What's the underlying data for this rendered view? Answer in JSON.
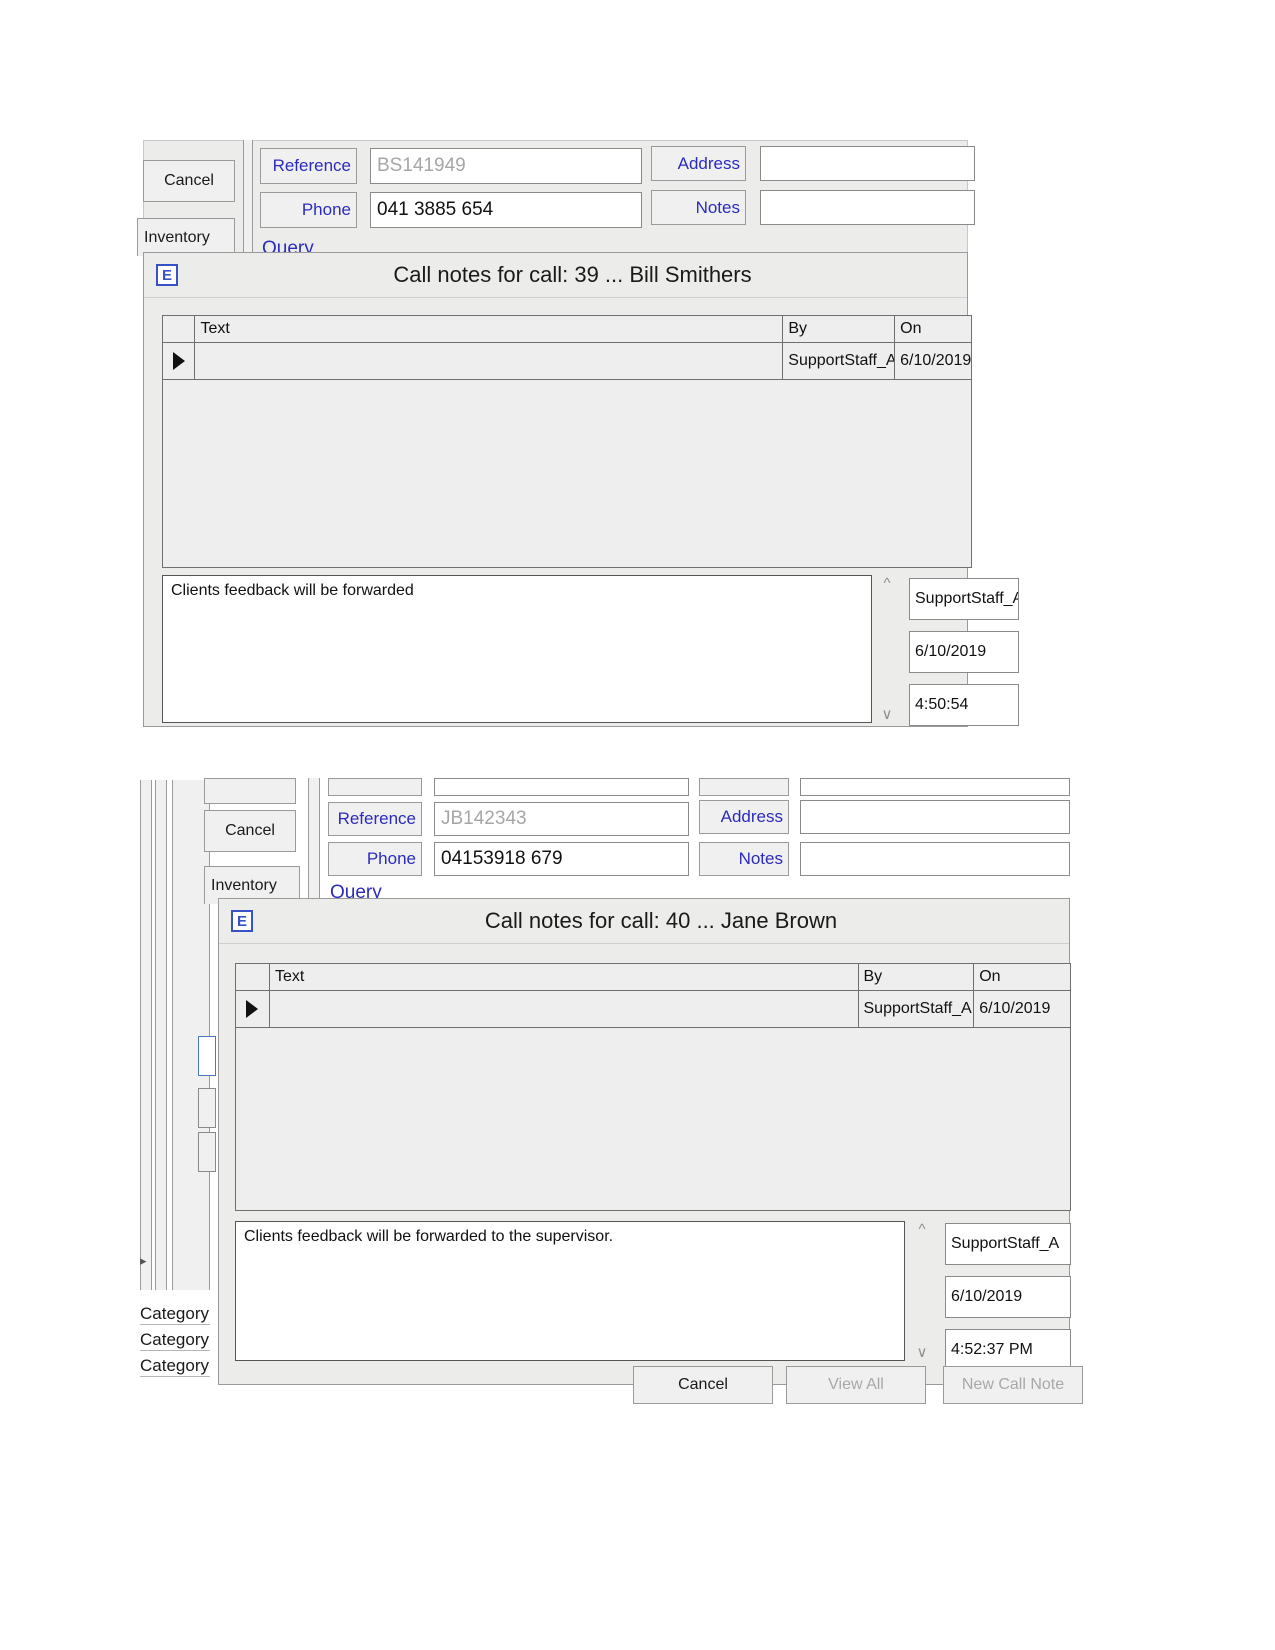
{
  "app": {
    "icon": "e-icon",
    "window_bg": "#ececeb"
  },
  "screen1": {
    "form": {
      "cancel_button": "Cancel",
      "inventory_tab": "Inventory",
      "query_label": "Query",
      "reference_label": "Reference",
      "reference_value": "BS141949",
      "phone_label": "Phone",
      "phone_value": "041 3885 654",
      "address_label": "Address",
      "address_value": "",
      "notes_label": "Notes",
      "notes_value": ""
    },
    "dialog": {
      "title": "Call notes for call:  39 ... Bill Smithers",
      "columns": [
        "Text",
        "By",
        "On"
      ],
      "rows": [
        {
          "selected": true,
          "text": "",
          "by": "SupportStaff_A",
          "on": "6/10/2019"
        }
      ],
      "note_text": "Clients feedback will be forwarded",
      "meta_by": "SupportStaff_A",
      "meta_date": "6/10/2019",
      "meta_time": "4:50:54"
    }
  },
  "screen2": {
    "form": {
      "cancel_button": "Cancel",
      "inventory_tab": "Inventory",
      "query_label": "Query",
      "reference_label": "Reference",
      "reference_value": "JB142343",
      "phone_label": "Phone",
      "phone_value": "04153918 679",
      "address_label": "Address",
      "address_value": "",
      "notes_label": "Notes",
      "notes_value": "",
      "categories": [
        "Category",
        "Category",
        "Category"
      ]
    },
    "dialog": {
      "title": "Call notes for call:  40 ... Jane Brown",
      "columns": [
        "Text",
        "By",
        "On"
      ],
      "rows": [
        {
          "selected": true,
          "text": "",
          "by": "SupportStaff_A",
          "on": "6/10/2019"
        }
      ],
      "note_text": "Clients feedback will be forwarded to the supervisor.",
      "meta_by": "SupportStaff_A",
      "meta_date": "6/10/2019",
      "meta_time": "4:52:37 PM",
      "buttons": {
        "cancel": "Cancel",
        "view_all": "View All",
        "new_call_note": "New Call Note"
      }
    }
  }
}
